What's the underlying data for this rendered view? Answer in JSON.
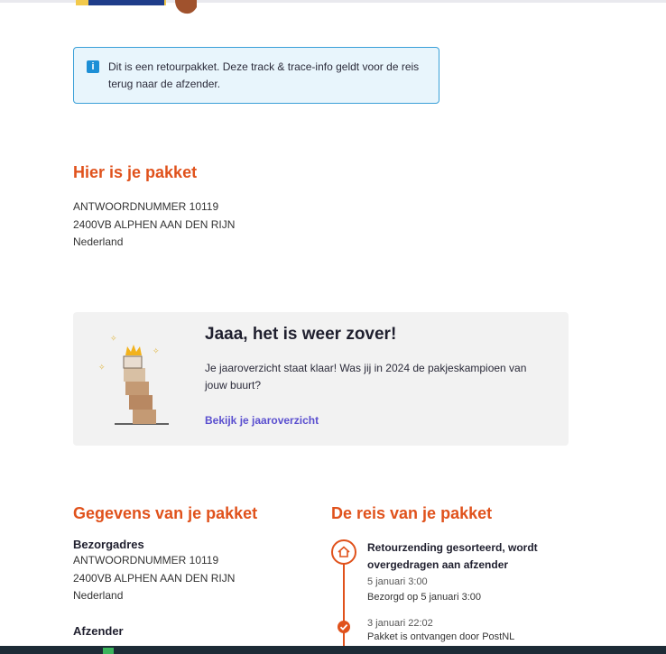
{
  "info": {
    "icon": "info-icon",
    "text": "Dit is een retourpakket. Deze track & trace-info geldt voor de reis terug naar de afzender."
  },
  "location": {
    "heading": "Hier is je pakket",
    "lines": [
      "ANTWOORDNUMMER 10119",
      "2400VB ALPHEN AAN DEN RIJN",
      "Nederland"
    ]
  },
  "promo": {
    "title": "Jaaa, het is weer zover!",
    "body": "Je jaaroverzicht staat klaar! Was jij in 2024 de pakjeskampioen van jouw buurt?",
    "link": "Bekijk je jaaroverzicht"
  },
  "details": {
    "heading": "Gegevens van je pakket",
    "delivery_label": "Bezorgadres",
    "delivery_lines": [
      "ANTWOORDNUMMER 10119",
      "2400VB ALPHEN AAN DEN RIJN",
      "Nederland"
    ],
    "sender_label": "Afzender"
  },
  "journey": {
    "heading": "De reis van je pakket",
    "events": [
      {
        "icon": "home-icon",
        "title": "Retourzending gesorteerd, wordt overgedragen aan afzender",
        "time": "5 januari 3:00",
        "note": "Bezorgd op 5 januari 3:00"
      },
      {
        "icon": "check-icon",
        "time": "3 januari 22:02",
        "note": "Pakket is ontvangen door PostNL"
      }
    ]
  },
  "colors": {
    "accent": "#e0521c",
    "info_border": "#3aa0d8",
    "info_bg": "#e8f5fc",
    "link": "#5a4fcf"
  }
}
